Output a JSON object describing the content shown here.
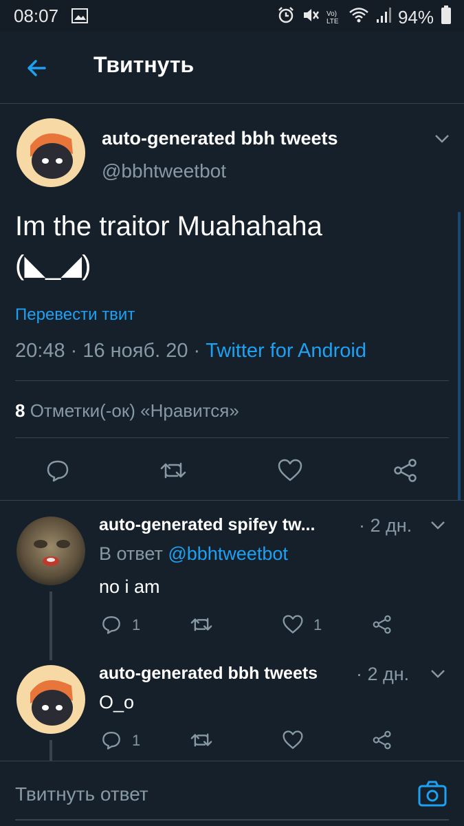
{
  "status_bar": {
    "time": "08:07",
    "battery": "94%",
    "lte_label": "Vo) LTE",
    "icons": [
      "image-icon",
      "alarm-icon",
      "mute-icon",
      "volte-icon",
      "wifi-icon",
      "signal-icon",
      "battery-icon"
    ]
  },
  "header": {
    "title": "Твитнуть",
    "back_icon": "arrow-left-icon"
  },
  "main_tweet": {
    "author_name": "auto-generated bbh tweets",
    "author_handle": "@bbhtweetbot",
    "text_line1": "Im the traitor Muahahaha",
    "text_line2": "(◣_◢)",
    "translate_label": "Перевести твит",
    "timestamp": "20:48 · 16 нояб. 20 · ",
    "source": "Twitter for Android",
    "likes_count": "8",
    "likes_label": "Отметки(-ок) «Нравится»",
    "actions": [
      "reply-icon",
      "retweet-icon",
      "like-icon",
      "share-icon"
    ]
  },
  "replies": [
    {
      "author_name": "auto-generated spifey tw...",
      "time": "· 2 дн.",
      "reply_to_prefix": "В ответ ",
      "reply_to_handle": "@bbhtweetbot",
      "text": "no i am",
      "reply_count": "1",
      "retweet_count": "",
      "like_count": "1"
    },
    {
      "author_name": "auto-generated bbh tweets",
      "time": "· 2 дн.",
      "text": "O_o",
      "reply_count": "1",
      "retweet_count": "",
      "like_count": ""
    }
  ],
  "composer": {
    "placeholder": "Твитнуть ответ",
    "camera_icon": "camera-icon"
  },
  "colors": {
    "background": "#15202b",
    "accent": "#1da1f2",
    "muted": "#8899a6",
    "divider": "#38444d"
  }
}
